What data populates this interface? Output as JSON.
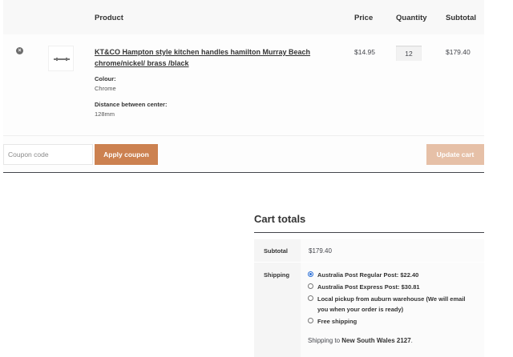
{
  "table_headers": {
    "product": "Product",
    "price": "Price",
    "quantity": "Quantity",
    "subtotal": "Subtotal"
  },
  "item": {
    "name": "KT&CO Hampton style kitchen handles hamilton Murray Beach chrome/nickel/ brass /black",
    "meta": [
      {
        "key": "Colour:",
        "value": "Chrome"
      },
      {
        "key": "Distance between center:",
        "value": "128mm"
      }
    ],
    "price": "$14.95",
    "quantity": "12",
    "subtotal": "$179.40",
    "remove_icon": "×"
  },
  "actions": {
    "coupon_placeholder": "Coupon code",
    "apply_label": "Apply coupon",
    "update_label": "Update cart"
  },
  "totals": {
    "title": "Cart totals",
    "subtotal_label": "Subtotal",
    "subtotal_value": "$179.40",
    "shipping_label": "Shipping",
    "options": [
      {
        "label": "Australia Post Regular Post: $22.40",
        "selected": true
      },
      {
        "label": "Australia Post Express Post: $30.81",
        "selected": false
      },
      {
        "label": "Local pickup from auburn warehouse (We will email you when your order is ready)",
        "selected": false
      },
      {
        "label": "Free shipping",
        "selected": false
      }
    ],
    "shipping_to_prefix": "Shipping to ",
    "shipping_to_location": "New South Wales 2127",
    "shipping_to_suffix": "."
  },
  "colors": {
    "accent": "#cc8150",
    "accent_disabled": "#e6c0a7",
    "radio_selected": "#2b6fd6"
  }
}
